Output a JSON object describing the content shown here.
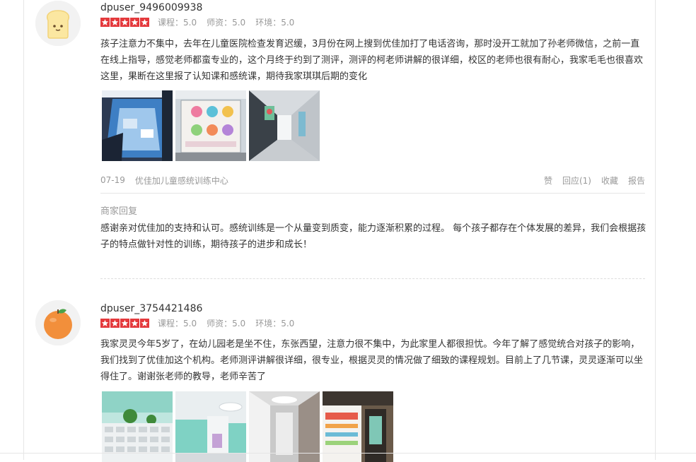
{
  "reviews": [
    {
      "username": "dpuser_9496009938",
      "avatar_icon": "toast-icon",
      "stars": 5,
      "scores": {
        "course": "课程：5.0",
        "teacher": "师资：5.0",
        "environment": "环境：5.0"
      },
      "content": "孩子注意力不集中，去年在儿童医院检查发育迟缓，3月份在网上搜到优佳加打了电话咨询，那时没开工就加了孙老师微信，之前一直在线上指导，感觉老师都蛮专业的，这个月终于约到了测评，测评的柯老师讲解的很详细，校区的老师也很有耐心，我家毛毛也很喜欢这里，果断在这里报了认知课和感统课，期待我家琪琪后期的变化",
      "date": "07-19",
      "shop": "优佳加儿童感统训练中心",
      "actions": {
        "like": "赞",
        "reply": "回应(1)",
        "collect": "收藏",
        "report": "报告"
      },
      "merchant_reply_title": "商家回复",
      "merchant_reply": "感谢亲对优佳加的支持和认可。感统训练是一个从量变到质变，能力逐渐积累的过程。 每个孩子都存在个体发展的差异，我们会根据孩子的特点做针对性的训练，期待孩子的进步和成长！"
    },
    {
      "username": "dpuser_3754421486",
      "avatar_icon": "orange-icon",
      "stars": 5,
      "scores": {
        "course": "课程：5.0",
        "teacher": "师资：5.0",
        "environment": "环境：5.0"
      },
      "content": "我家灵灵今年5岁了，在幼儿园老是坐不住，东张西望，注意力很不集中，为此家里人都很担忧。今年了解了感觉统合对孩子的影响，我们找到了优佳加这个机构。老师测评讲解很详细，很专业，根据灵灵的情况做了细致的课程规划。目前上了几节课，灵灵逐渐可以坐得住了。谢谢张老师的教导，老师辛苦了"
    }
  ]
}
